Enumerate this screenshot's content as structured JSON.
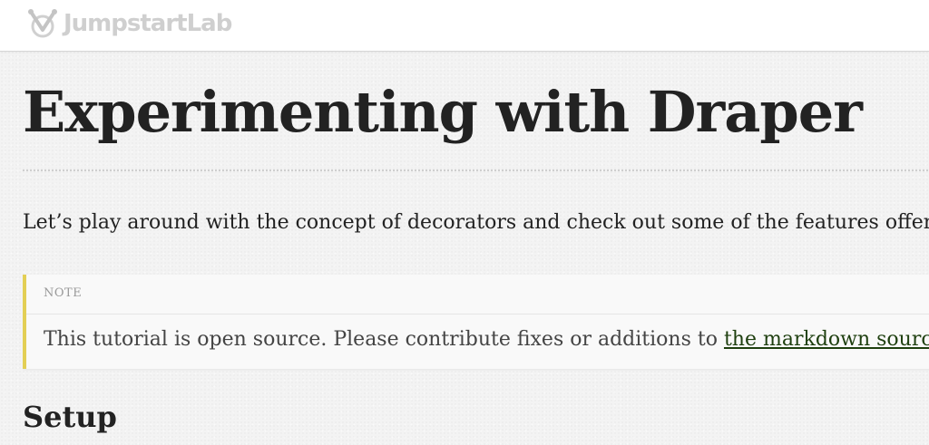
{
  "header": {
    "logo_text": "JumpstartLab"
  },
  "page": {
    "title": "Experimenting with Draper",
    "intro": "Let’s play around with the concept of decorators and check out some of the features offered",
    "note": {
      "label": "NOTE",
      "text": "This tutorial is open source. Please contribute fixes or additions to ",
      "link_text": "the markdown source on GitHub"
    },
    "section_heading": "Setup"
  },
  "colors": {
    "note_accent": "#e3cf55",
    "link": "#1e3f0f",
    "logo_gray": "#cfcfcf"
  }
}
